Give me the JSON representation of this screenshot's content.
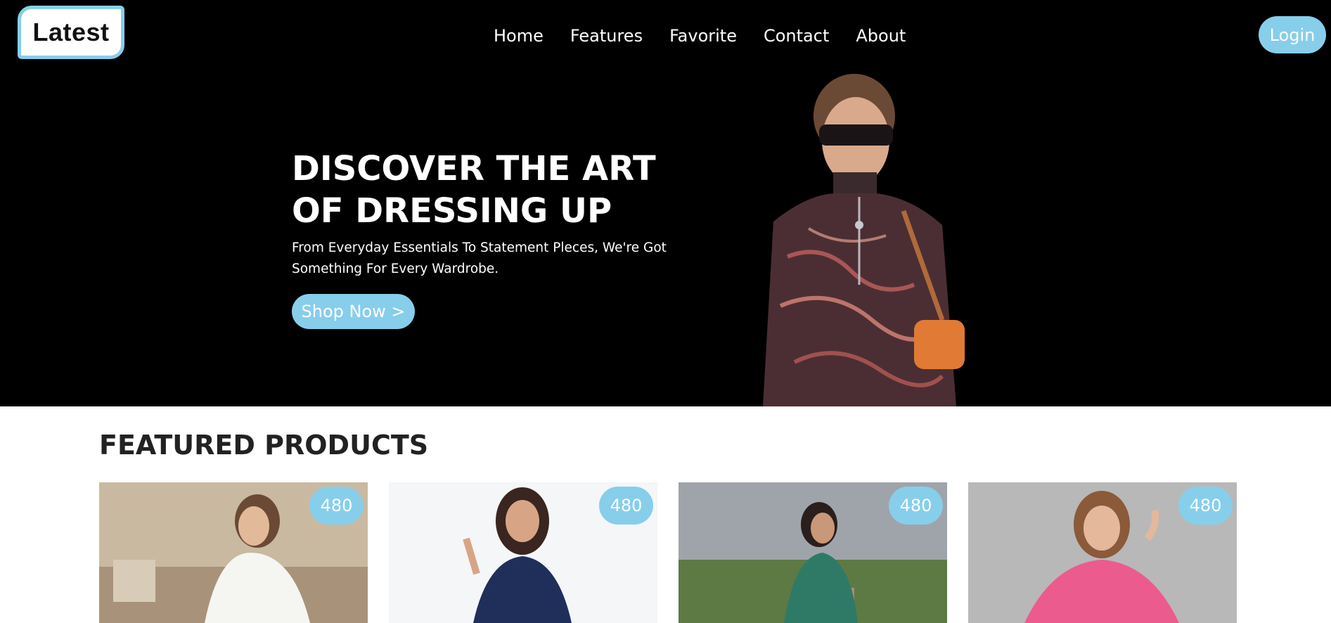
{
  "header": {
    "logo_text": "Latest",
    "nav": [
      "Home",
      "Features",
      "Favorite",
      "Contact",
      "About"
    ],
    "login_label": "Login"
  },
  "hero": {
    "title_line1": "DISCOVER THE ART",
    "title_line2": "OF DRESSING UP",
    "subtitle_line1": "From Everyday Essentials To Statement Pleces, We're Got",
    "subtitle_line2": "Something For Every Wardrobe.",
    "cta_label": "Shop Now >"
  },
  "featured": {
    "title": "FEATURED PRODUCTS",
    "products": [
      {
        "price": "480",
        "image": "woman-white-dress"
      },
      {
        "price": "480",
        "image": "woman-navy-dress"
      },
      {
        "price": "480",
        "image": "woman-green-dress"
      },
      {
        "price": "480",
        "image": "woman-pink-kaftan"
      }
    ]
  },
  "colors": {
    "accent": "#87ceeb",
    "hero_bg": "#000000"
  }
}
